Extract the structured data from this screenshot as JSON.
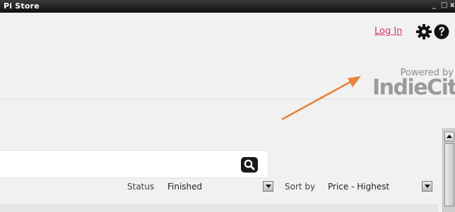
{
  "window": {
    "title": "Pi Store",
    "minimize": "_",
    "maximize": "□",
    "close": "x"
  },
  "header": {
    "login": "Log In",
    "settings_icon": "gear-icon",
    "help_icon": "help-icon",
    "powered_by": "Powered by",
    "brand": "IndieCity"
  },
  "search": {
    "icon": "search-icon",
    "value": ""
  },
  "filters": {
    "status_label": "Status",
    "status_value": "Finished",
    "sort_label": "Sort by",
    "sort_value": "Price - Highest"
  },
  "colors": {
    "login_link": "#d6345c",
    "arrow": "#e8823a",
    "brand": "#9a9a9a"
  }
}
